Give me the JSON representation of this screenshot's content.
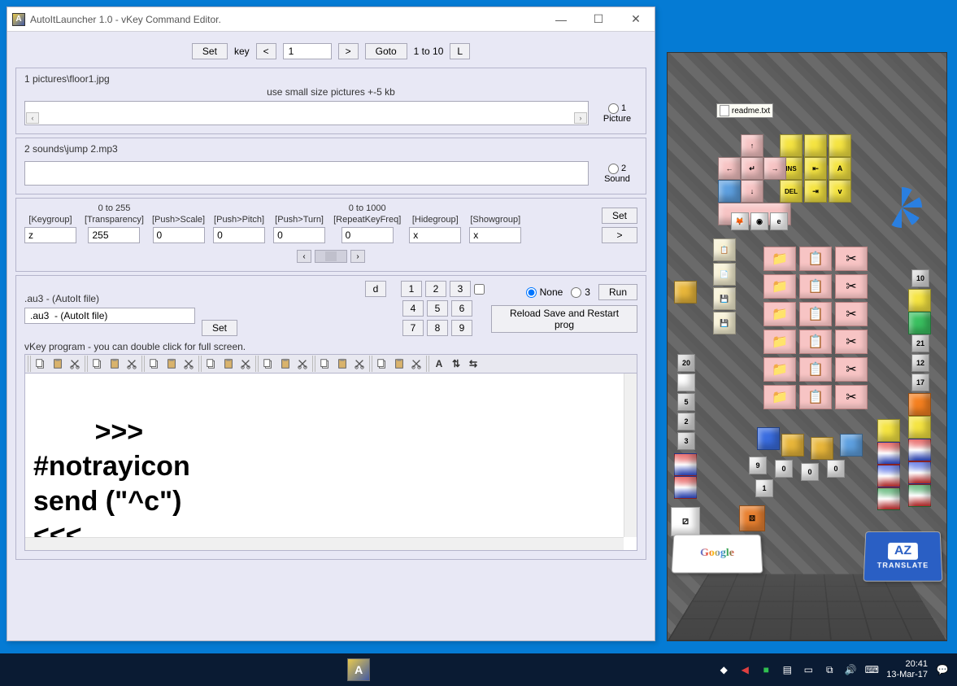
{
  "window": {
    "title": "AutoItLauncher 1.0 - vKey Command Editor."
  },
  "nav": {
    "set": "Set",
    "key_label": "key",
    "prev": "<",
    "key_value": "1",
    "next": ">",
    "goto": "Goto",
    "range": "1 to 10",
    "l_btn": "L"
  },
  "panel_picture": {
    "title": "1 pictures\\floor1.jpg",
    "hint": "use small size pictures +-5 kb",
    "radio_num": "1",
    "radio_label": "Picture"
  },
  "panel_sound": {
    "title": "2 sounds\\jump 2.mp3",
    "radio_num": "2",
    "radio_label": "Sound"
  },
  "params": {
    "hint_255": "0 to 255",
    "hint_1000": "0  to 1000",
    "cols": [
      {
        "label": "[Keygroup]",
        "value": "z"
      },
      {
        "label": "[Transparency]",
        "value": "255"
      },
      {
        "label": "[Push>Scale]",
        "value": "0"
      },
      {
        "label": "[Push>Pitch]",
        "value": "0"
      },
      {
        "label": "[Push>Turn]",
        "value": "0"
      },
      {
        "label": "[RepeatKeyFreq]",
        "value": "0"
      },
      {
        "label": "[Hidegroup]",
        "value": "x"
      },
      {
        "label": "[Showgroup]",
        "value": "x"
      }
    ],
    "set": "Set",
    "next": ">"
  },
  "script": {
    "file_label": ".au3  - (AutoIt file)",
    "file_value": ".au3  - (AutoIt file)",
    "set": "Set",
    "d_btn": "d",
    "numbers": [
      "1",
      "2",
      "3",
      "4",
      "5",
      "6",
      "7",
      "8",
      "9"
    ],
    "radio_none": "None",
    "radio_3": "3",
    "run": "Run",
    "reload": "Reload Save and Restart prog",
    "hint": "vKey  program - you can double click for full screen.",
    "code": ">>>\n#notrayicon\nsend (\"^c\")\n<<<"
  },
  "toolbar_groups": 7,
  "pane3d": {
    "readme": "readme.txt",
    "google": "Google",
    "translate": "TRANSLATE",
    "az": "AZ"
  },
  "taskbar": {
    "time": "20:41",
    "date": "13-Mar-17"
  }
}
